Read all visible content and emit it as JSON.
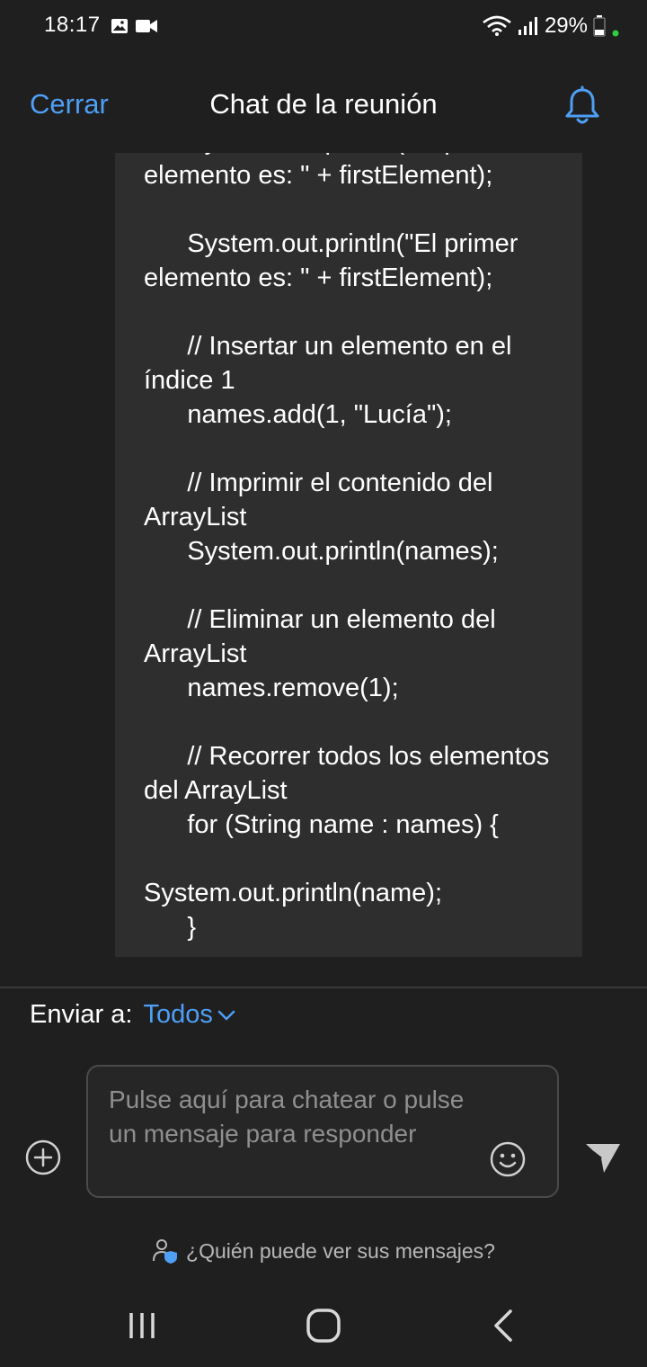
{
  "status_bar": {
    "time": "18:17",
    "battery": "29%",
    "icons": [
      "image-icon",
      "video-camera-icon",
      "wifi-icon",
      "signal-icon",
      "battery-icon",
      "active-dot-icon"
    ],
    "active_dot_color": "#2ecc40"
  },
  "header": {
    "close_label": "Cerrar",
    "title": "Chat de la reunión",
    "bell_icon": "bell-icon"
  },
  "message": {
    "code": "      System.out.println(\"El primer elemento es: \" + firstElement);\n\n      System.out.println(\"El primer elemento es: \" + firstElement);\n\n      // Insertar un elemento en el índice 1\n      names.add(1, \"Lucía\");\n\n      // Imprimir el contenido del ArrayList\n      System.out.println(names);\n\n      // Eliminar un elemento del ArrayList\n      names.remove(1);\n\n      // Recorrer todos los elementos del ArrayList\n      for (String name : names) {\n\nSystem.out.println(name);\n      }\n\n      // Buscar un elemento en el"
  },
  "send_to": {
    "label": "Enviar a:",
    "target": "Todos"
  },
  "composer": {
    "placeholder": "Pulse aquí para chatear o pulse un mensaje para responder"
  },
  "privacy": {
    "label": "¿Quién puede ver sus mensajes?"
  },
  "colors": {
    "accent": "#4e9ff5",
    "background": "#1f1f1f",
    "bubble": "#2e2e2e"
  }
}
